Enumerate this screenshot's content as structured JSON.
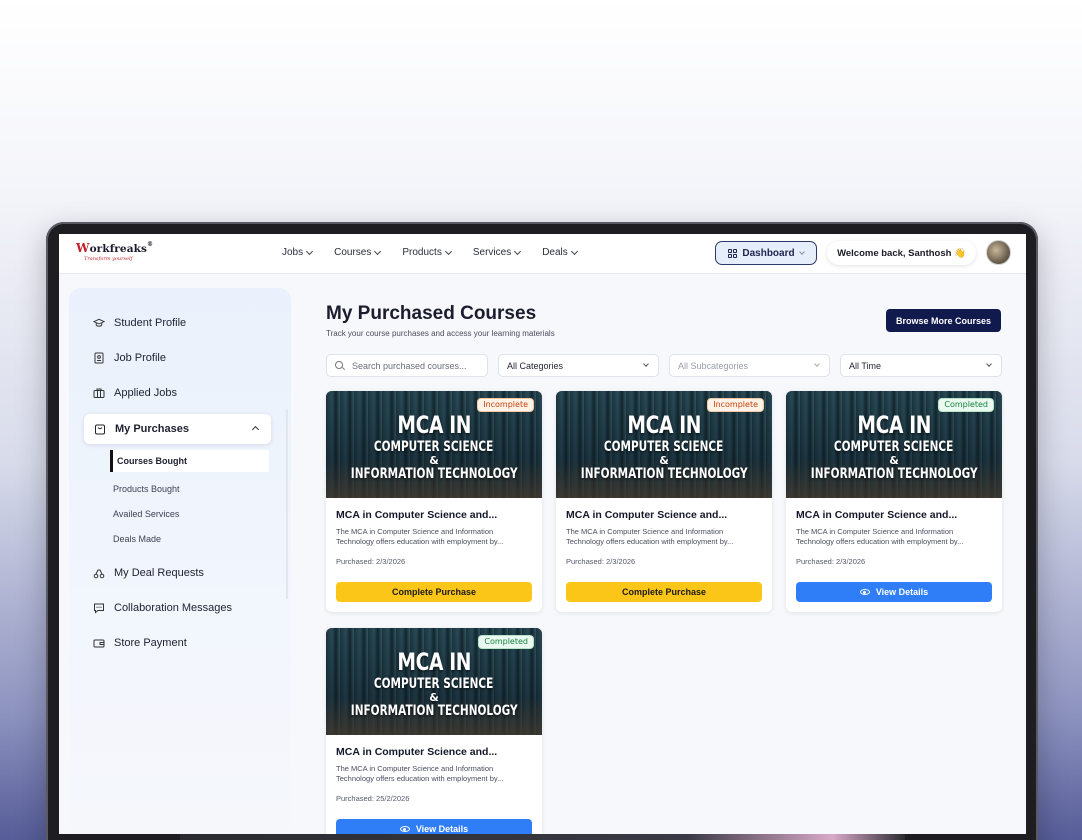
{
  "brand": {
    "name_w": "W",
    "name_rest": "orkfreaks",
    "reg": "®",
    "tagline": "Transform yourself"
  },
  "nav": {
    "menu": [
      {
        "label": "Jobs"
      },
      {
        "label": "Courses"
      },
      {
        "label": "Products"
      },
      {
        "label": "Services"
      },
      {
        "label": "Deals"
      }
    ],
    "dashboard_label": "Dashboard",
    "welcome": "Welcome back, Santhosh 👋"
  },
  "sidebar": {
    "items": [
      {
        "label": "Student Profile",
        "icon": "graduation-cap-icon"
      },
      {
        "label": "Job Profile",
        "icon": "id-badge-icon"
      },
      {
        "label": "Applied Jobs",
        "icon": "briefcase-icon"
      },
      {
        "label": "My Purchases",
        "icon": "shopping-bag-icon"
      },
      {
        "label": "My Deal Requests",
        "icon": "deal-icon"
      },
      {
        "label": "Collaboration Messages",
        "icon": "message-icon"
      },
      {
        "label": "Store Payment",
        "icon": "wallet-icon"
      }
    ],
    "sub_items": [
      {
        "label": "Courses Bought"
      },
      {
        "label": "Products Bought"
      },
      {
        "label": "Availed Services"
      },
      {
        "label": "Deals Made"
      }
    ]
  },
  "main": {
    "title": "My Purchased Courses",
    "subtitle": "Track your course purchases and access your learning materials",
    "browse_button": "Browse More Courses",
    "filters": {
      "search_placeholder": "Search purchased courses...",
      "category": "All Categories",
      "subcategory": "All Subcategories",
      "time": "All Time"
    },
    "cards": [
      {
        "badge": "Incomplete",
        "thumb_line1": "MCA IN",
        "thumb_line2": "COMPUTER SCIENCE",
        "thumb_line3": "&",
        "thumb_line4": "INFORMATION TECHNOLOGY",
        "title": "MCA in Computer Science and...",
        "desc": "The MCA in Computer Science and Information Technology offers education with employment by...",
        "date": "Purchased: 2/3/2026",
        "button": "Complete Purchase"
      },
      {
        "badge": "Incomplete",
        "thumb_line1": "MCA IN",
        "thumb_line2": "COMPUTER SCIENCE",
        "thumb_line3": "&",
        "thumb_line4": "INFORMATION TECHNOLOGY",
        "title": "MCA in Computer Science and...",
        "desc": "The MCA in Computer Science and Information Technology offers education with employment by...",
        "date": "Purchased: 2/3/2026",
        "button": "Complete Purchase"
      },
      {
        "badge": "Completed",
        "thumb_line1": "MCA IN",
        "thumb_line2": "COMPUTER SCIENCE",
        "thumb_line3": "&",
        "thumb_line4": "INFORMATION TECHNOLOGY",
        "title": "MCA in Computer Science and...",
        "desc": "The MCA in Computer Science and Information Technology offers education with employment by...",
        "date": "Purchased: 2/3/2026",
        "button": "View Details"
      },
      {
        "badge": "Completed",
        "thumb_line1": "MCA IN",
        "thumb_line2": "COMPUTER SCIENCE",
        "thumb_line3": "&",
        "thumb_line4": "INFORMATION TECHNOLOGY",
        "title": "MCA in Computer Science and...",
        "desc": "The MCA in Computer Science and Information Technology offers education with employment by...",
        "date": "Purchased: 25/2/2026",
        "button": "View Details"
      }
    ]
  },
  "colors": {
    "accent_navy": "#111a4d",
    "button_yellow": "#fcc619",
    "button_blue": "#2f7ef7",
    "badge_incomplete": "#c2410c",
    "badge_completed": "#15803d"
  }
}
